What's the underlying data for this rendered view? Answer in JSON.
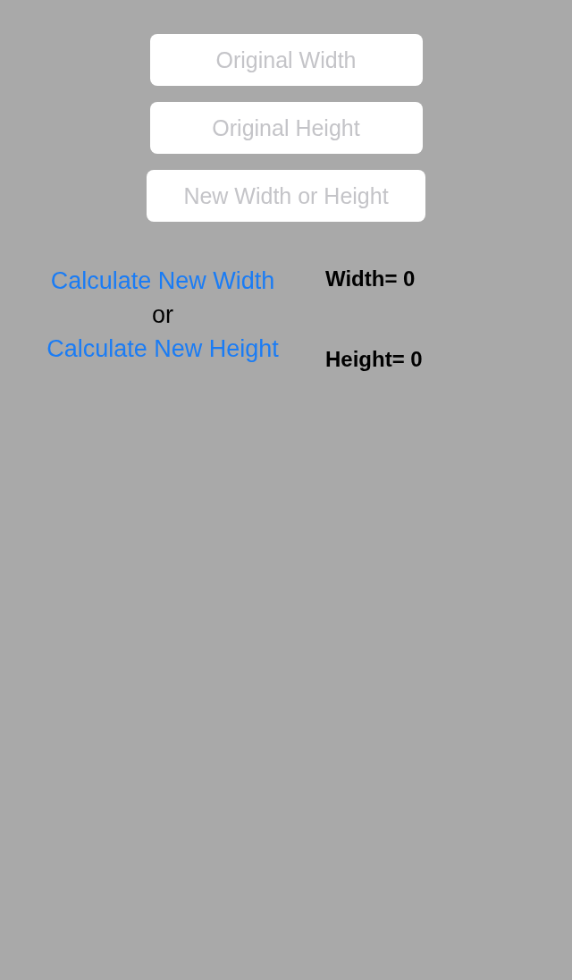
{
  "fields": [
    {
      "placeholder": "Original Width"
    },
    {
      "placeholder": "Original Height"
    },
    {
      "placeholder": "New Width or Height"
    }
  ],
  "actions": [
    {
      "label": "Calculate New Width",
      "result": "Width= 0"
    },
    {
      "label": "Calculate New Height",
      "result": "Height= 0"
    }
  ],
  "separator": "or"
}
